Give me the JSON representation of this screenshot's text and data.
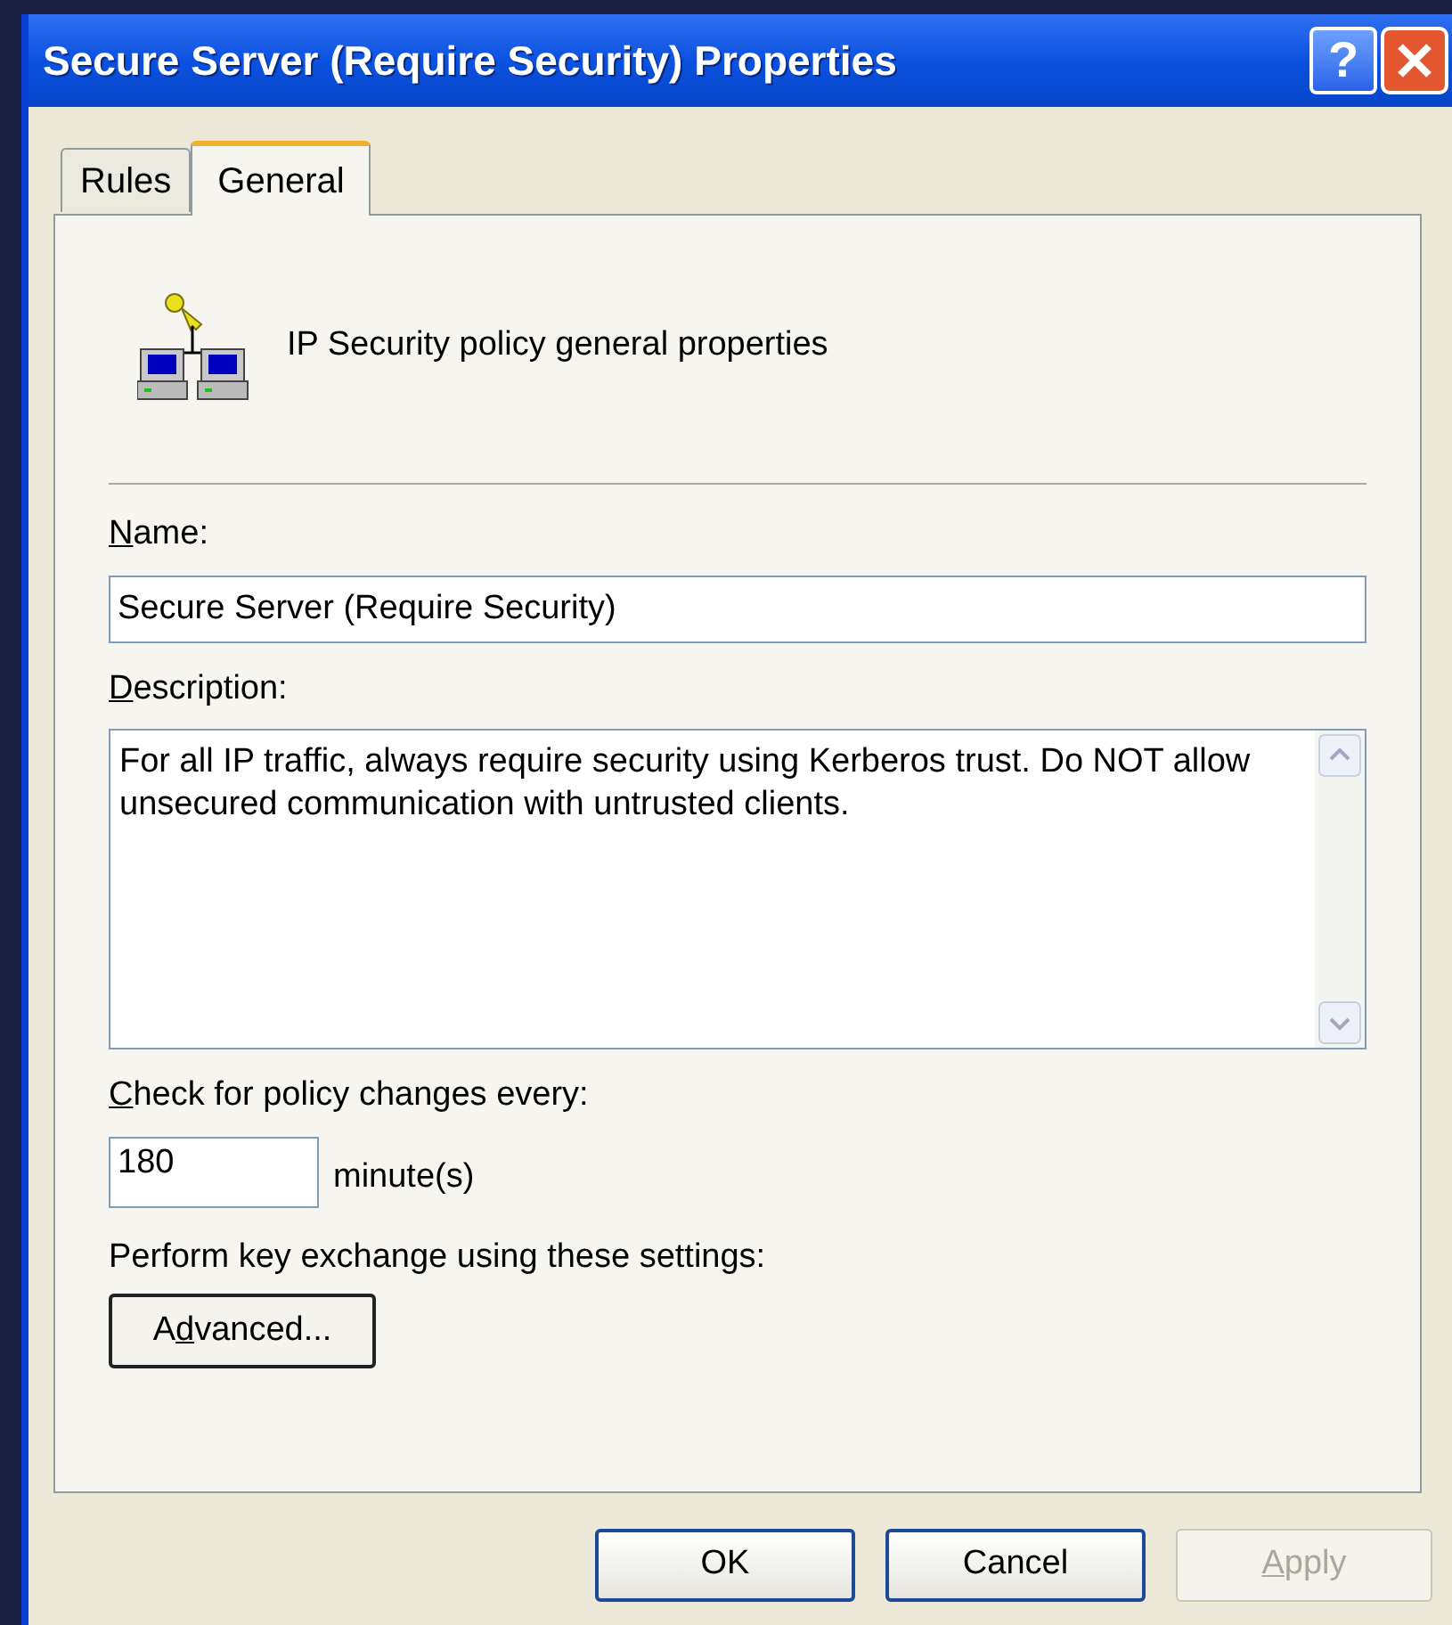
{
  "window": {
    "title": "Secure Server (Require Security) Properties",
    "help_button": "?"
  },
  "tabs": [
    {
      "label": "Rules",
      "selected": false
    },
    {
      "label": "General",
      "selected": true
    }
  ],
  "header": {
    "text": "IP Security policy general properties"
  },
  "name": {
    "label": [
      {
        "text": "N",
        "underlined": true
      },
      {
        "text": "ame:",
        "underlined": false
      }
    ],
    "value": "Secure Server (Require Security)"
  },
  "description": {
    "label": [
      {
        "text": "D",
        "underlined": true
      },
      {
        "text": "escription:",
        "underlined": false
      }
    ],
    "value": "For all IP traffic, always require security using Kerberos trust. Do NOT allow unsecured communication with untrusted clients."
  },
  "check": {
    "label": [
      {
        "text": "C",
        "underlined": true
      },
      {
        "text": "heck for policy changes every:",
        "underlined": false
      }
    ],
    "value": "180",
    "unit": "minute(s)"
  },
  "key_exchange": {
    "label": "Perform key exchange using these settings:",
    "button": [
      {
        "text": "A",
        "underlined": false
      },
      {
        "text": "d",
        "underlined": true
      },
      {
        "text": "vanced...",
        "underlined": false
      }
    ]
  },
  "buttons": [
    {
      "label": [
        {
          "text": "OK",
          "underlined": false
        }
      ],
      "disabled": false
    },
    {
      "label": [
        {
          "text": "Cancel",
          "underlined": false
        }
      ],
      "disabled": false
    },
    {
      "label": [
        {
          "text": "A",
          "underlined": true
        },
        {
          "text": "pply",
          "underlined": false
        }
      ],
      "disabled": true
    }
  ]
}
